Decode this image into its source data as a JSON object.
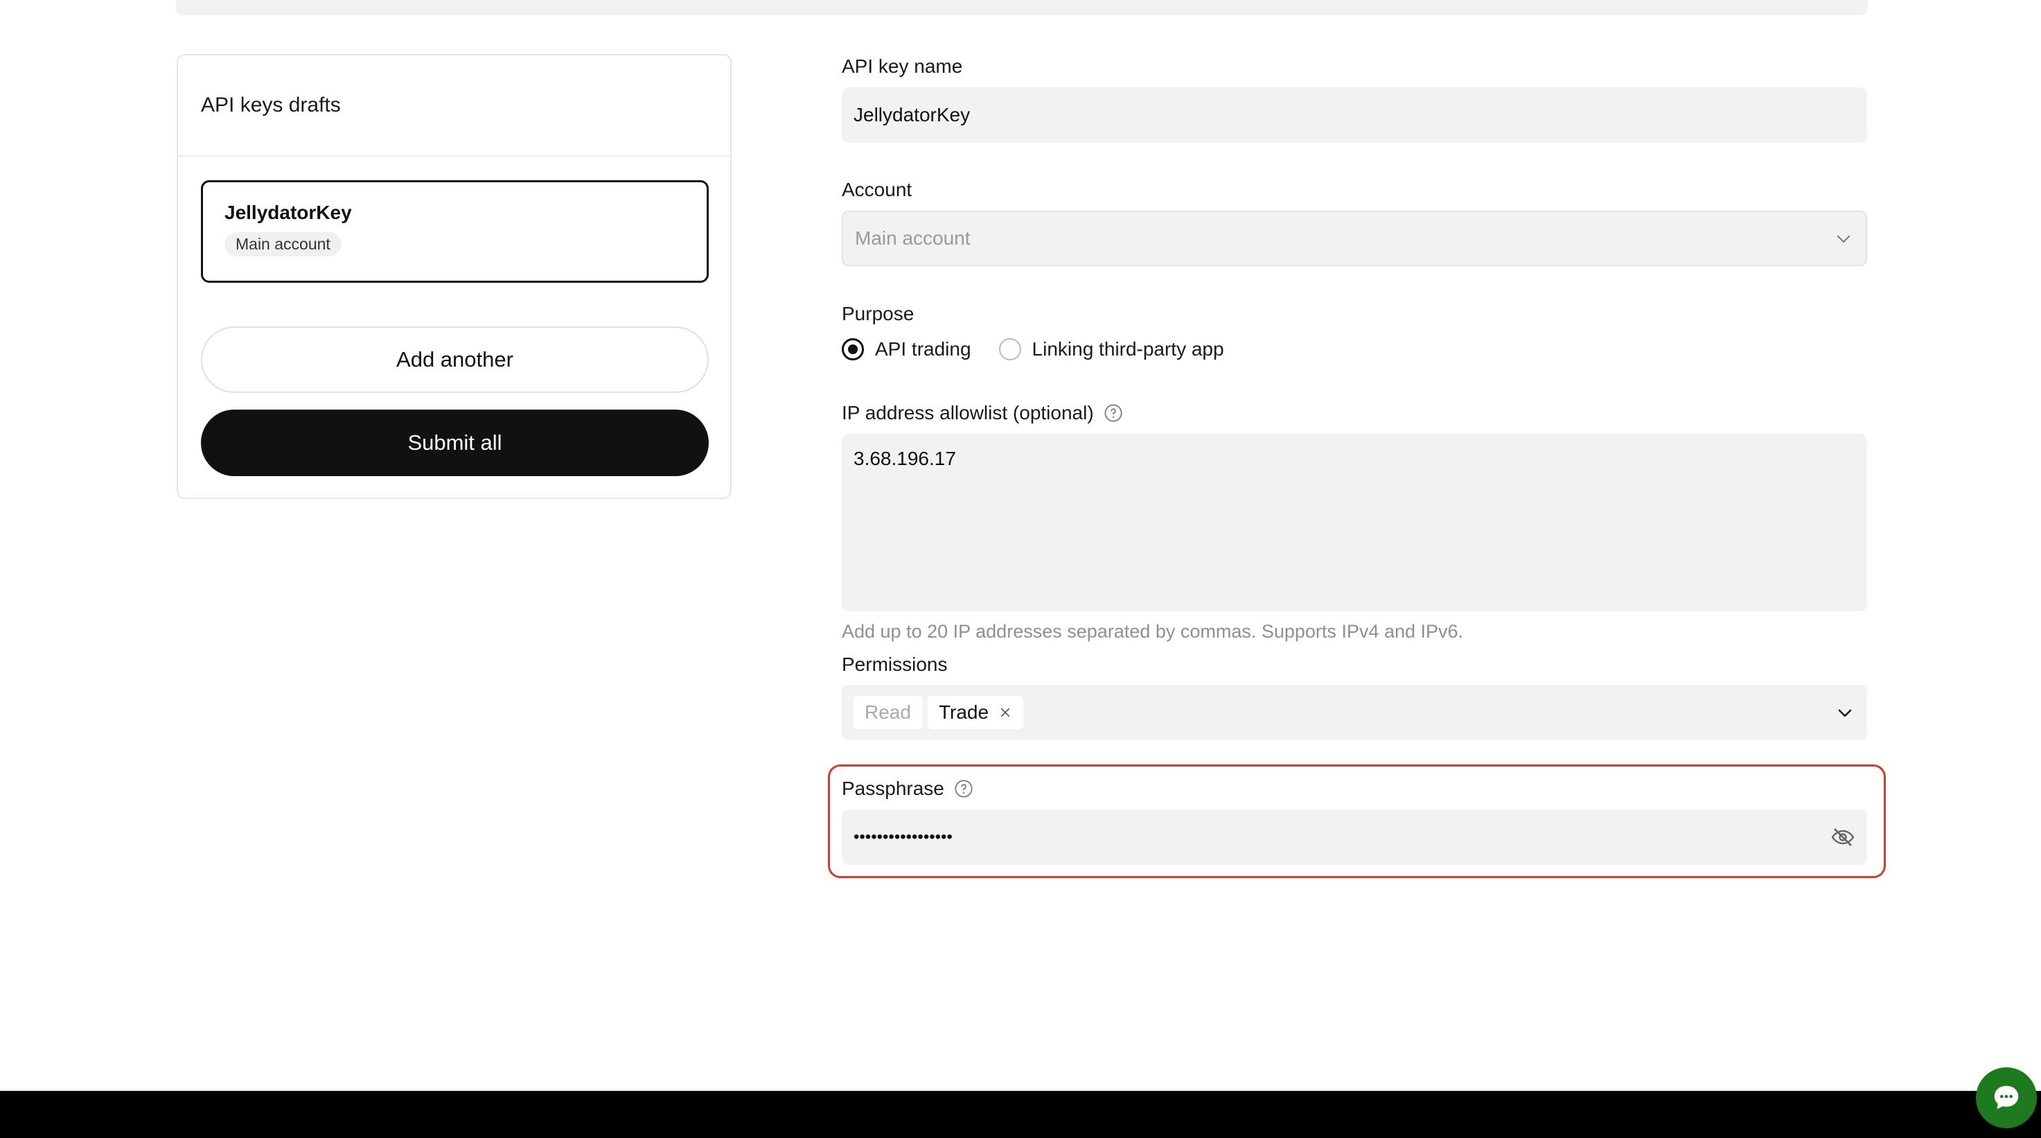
{
  "drafts": {
    "title": "API keys drafts",
    "items": [
      {
        "name": "JellydatorKey",
        "account": "Main account"
      }
    ],
    "add_label": "Add another",
    "submit_label": "Submit all"
  },
  "form": {
    "name_label": "API key name",
    "name_value": "JellydatorKey",
    "account_label": "Account",
    "account_value": "Main account",
    "purpose_label": "Purpose",
    "purpose_options": [
      {
        "label": "API trading",
        "selected": true
      },
      {
        "label": "Linking third-party app",
        "selected": false
      }
    ],
    "ip_label": "IP address allowlist (optional)",
    "ip_value": "3.68.196.17",
    "ip_hint": "Add up to 20 IP addresses separated by commas. Supports IPv4 and IPv6.",
    "permissions_label": "Permissions",
    "permissions": [
      {
        "label": "Read",
        "removable": false
      },
      {
        "label": "Trade",
        "removable": true
      }
    ],
    "passphrase_label": "Passphrase",
    "passphrase_masked": "•••••••••••••••••"
  },
  "colors": {
    "error_border": "#d93b26",
    "chat_button": "#1e7a1e",
    "primary_button": "#111111"
  },
  "icons": {
    "account_chevron": "chevron-down-icon",
    "help": "question-circle-icon",
    "remove_chip": "close-icon",
    "passphrase_visibility": "eye-off-icon",
    "chat": "chat-bubble-icon"
  }
}
